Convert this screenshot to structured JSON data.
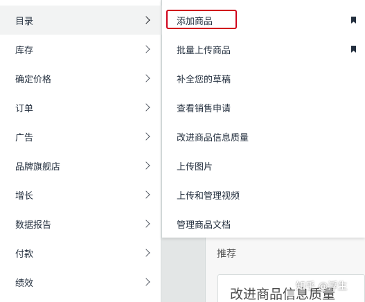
{
  "sidebar": {
    "items": [
      {
        "label": "目录",
        "active": true
      },
      {
        "label": "库存"
      },
      {
        "label": "确定价格"
      },
      {
        "label": "订单"
      },
      {
        "label": "广告"
      },
      {
        "label": "品牌旗舰店"
      },
      {
        "label": "增长"
      },
      {
        "label": "数据报告"
      },
      {
        "label": "付款"
      },
      {
        "label": "绩效"
      }
    ]
  },
  "flyout": {
    "items": [
      {
        "label": "添加商品",
        "bookmarked": true,
        "highlighted": true
      },
      {
        "label": "批量上传商品",
        "bookmarked": true
      },
      {
        "label": "补全您的草稿"
      },
      {
        "label": "查看销售申请"
      },
      {
        "label": "改进商品信息质量"
      },
      {
        "label": "上传图片"
      },
      {
        "label": "上传和管理视频"
      },
      {
        "label": "管理商品文档"
      }
    ]
  },
  "background": {
    "recommend_label": "推荐",
    "card_text": "改进商品信息质量"
  },
  "watermark": "知乎 @浮生",
  "colors": {
    "highlight_border": "#d0021b",
    "text": "#232f3e",
    "active_row": "#f2f3f3"
  }
}
